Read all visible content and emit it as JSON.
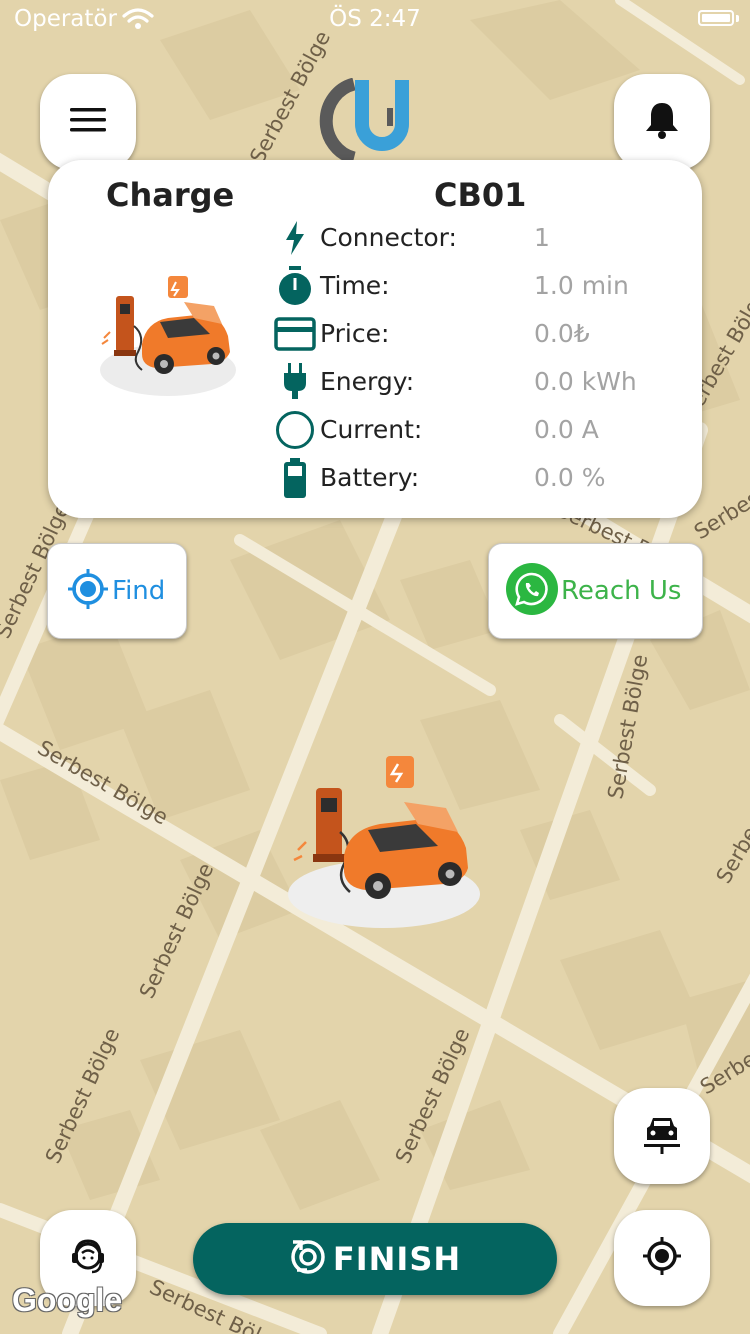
{
  "status_bar": {
    "carrier": "Operatör",
    "time": "ÖS 2:47"
  },
  "map": {
    "street_labels": [
      "Serbest Bölge",
      "Serbest Bölge",
      "Serbest Bölge",
      "Serbest Bölge",
      "Serbest Bölge",
      "Serbest Bölge",
      "Serbest Bölge",
      "Serbest Bölge",
      "Serbest Bölge",
      "Serbest Bölge",
      "Serbest Bölge",
      "Serbest Bölge",
      "Serbest Bölge"
    ],
    "attribution": "Google"
  },
  "header": {
    "menu_icon": "hamburger-menu-icon",
    "notification_icon": "bell-icon"
  },
  "charge_card": {
    "title": "Charge",
    "station_id": "CB01",
    "rows": [
      {
        "icon": "lightning-icon",
        "label": "Connector:",
        "value": "1"
      },
      {
        "icon": "stopwatch-icon",
        "label": "Time:",
        "value": "1.0 min"
      },
      {
        "icon": "credit-card-icon",
        "label": "Price:",
        "value": "0.0₺"
      },
      {
        "icon": "plug-icon",
        "label": "Energy:",
        "value": "0.0 kWh"
      },
      {
        "icon": "circle-gauge-icon",
        "label": "Current:",
        "value": "0.0 A"
      },
      {
        "icon": "battery-icon",
        "label": "Battery:",
        "value": "0.0 %"
      }
    ]
  },
  "actions": {
    "find_label": "Find",
    "reach_label": "Reach Us",
    "finish_label": "FINISH"
  },
  "colors": {
    "primary": "#04645f",
    "find_blue": "#1f8fe0",
    "whatsapp_green": "#3db34a",
    "value_gray": "#a3a3a3",
    "map_background": "#e3d4ab"
  }
}
